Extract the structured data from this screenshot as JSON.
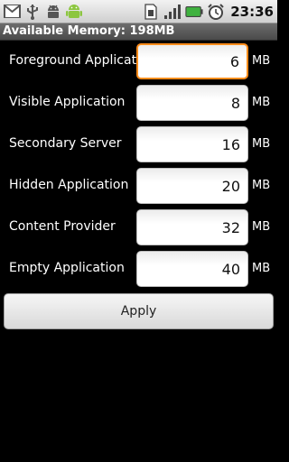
{
  "status_bar": {
    "time": "23:36",
    "left_icons": [
      "gmail-icon",
      "usb-icon",
      "android-debug-icon",
      "android-robot-icon"
    ],
    "right_icons": [
      "sim-card-icon",
      "signal-icon",
      "battery-icon",
      "alarm-icon"
    ]
  },
  "title": "Available Memory: 198MB",
  "rows": [
    {
      "label": "Foreground Application",
      "value": "6",
      "unit": "MB"
    },
    {
      "label": "Visible Application",
      "value": "8",
      "unit": "MB"
    },
    {
      "label": "Secondary Server",
      "value": "16",
      "unit": "MB"
    },
    {
      "label": "Hidden Application",
      "value": "20",
      "unit": "MB"
    },
    {
      "label": "Content Provider",
      "value": "32",
      "unit": "MB"
    },
    {
      "label": "Empty Application",
      "value": "40",
      "unit": "MB"
    }
  ],
  "apply_label": "Apply",
  "colors": {
    "focus": "#ff8c1a",
    "background": "#000000",
    "status_bar": "#e0e0e0",
    "title_bar": "#5a5a5a"
  }
}
